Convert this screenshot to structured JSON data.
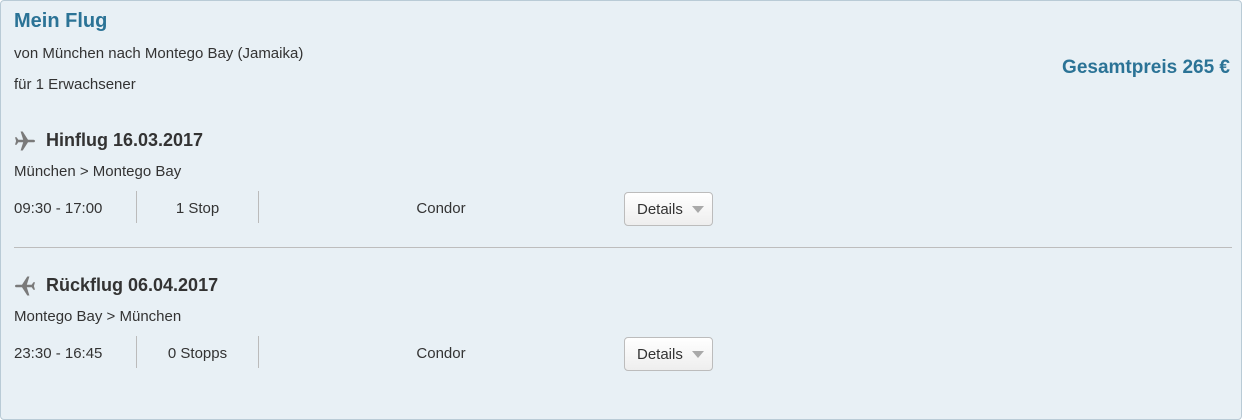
{
  "summary": {
    "title": "Mein Flug",
    "route": "von München nach Montego Bay (Jamaika)",
    "passengers": "für 1 Erwachsener",
    "total_price": "Gesamtpreis 265 €"
  },
  "legs": [
    {
      "title": "Hinflug 16.03.2017",
      "route": "München > Montego Bay",
      "time": "09:30 - 17:00",
      "stops": "1 Stop",
      "airline": "Condor",
      "details_label": "Details",
      "icon": "plane-right-icon"
    },
    {
      "title": "Rückflug 06.04.2017",
      "route": "Montego Bay > München",
      "time": "23:30 - 16:45",
      "stops": "0 Stopps",
      "airline": "Condor",
      "details_label": "Details",
      "icon": "plane-left-icon"
    }
  ],
  "colors": {
    "accent": "#2b7396",
    "panel_background": "#e8f0f5",
    "icon": "#7a7a7a"
  }
}
